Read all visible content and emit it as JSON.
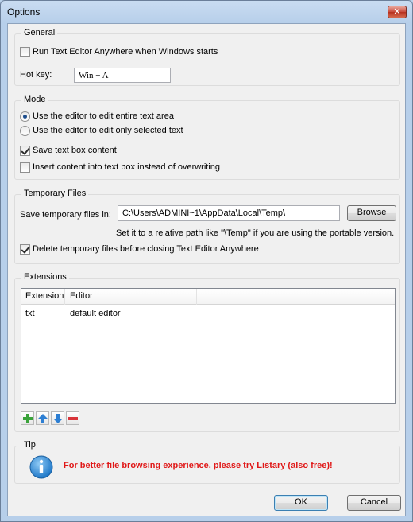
{
  "window": {
    "title": "Options",
    "close_label": "✕"
  },
  "general": {
    "title": "General",
    "run_on_startup": {
      "label": "Run Text Editor Anywhere when Windows starts",
      "checked": false
    },
    "hotkey_label": "Hot key:",
    "hotkey_value": "Win + A"
  },
  "mode": {
    "title": "Mode",
    "radio_entire": {
      "label": "Use the editor to edit entire text area",
      "checked": true
    },
    "radio_selected": {
      "label": "Use the editor to edit only selected text",
      "checked": false
    },
    "save_textbox": {
      "label": "Save text box content",
      "checked": true
    },
    "insert_content": {
      "label": "Insert content into text box instead of overwriting",
      "checked": false
    }
  },
  "temp_files": {
    "title": "Temporary Files",
    "save_label": "Save temporary files in:",
    "path_value": "C:\\Users\\ADMINI~1\\AppData\\Local\\Temp\\",
    "browse_label": "Browse",
    "hint": "Set it to a relative path like \"\\Temp\" if you are using the portable version.",
    "delete_before_close": {
      "label": "Delete temporary files before closing Text Editor Anywhere",
      "checked": true
    }
  },
  "extensions": {
    "title": "Extensions",
    "columns": [
      "Extension",
      "Editor"
    ],
    "rows": [
      {
        "extension": "txt",
        "editor": "default editor"
      }
    ],
    "toolbar_icons": [
      "add-icon",
      "move-up-icon",
      "move-down-icon",
      "remove-icon"
    ]
  },
  "tip": {
    "title": "Tip",
    "icon": "info-icon",
    "link_text": "For better file browsing experience, please try Listary (also free)!"
  },
  "footer": {
    "ok_label": "OK",
    "cancel_label": "Cancel"
  },
  "colors": {
    "link": "#e01818",
    "info_icon": "#2f8fd8",
    "add_icon": "#3aa33a",
    "arrow_icon": "#2d7fd3",
    "remove_icon": "#d9343a"
  }
}
